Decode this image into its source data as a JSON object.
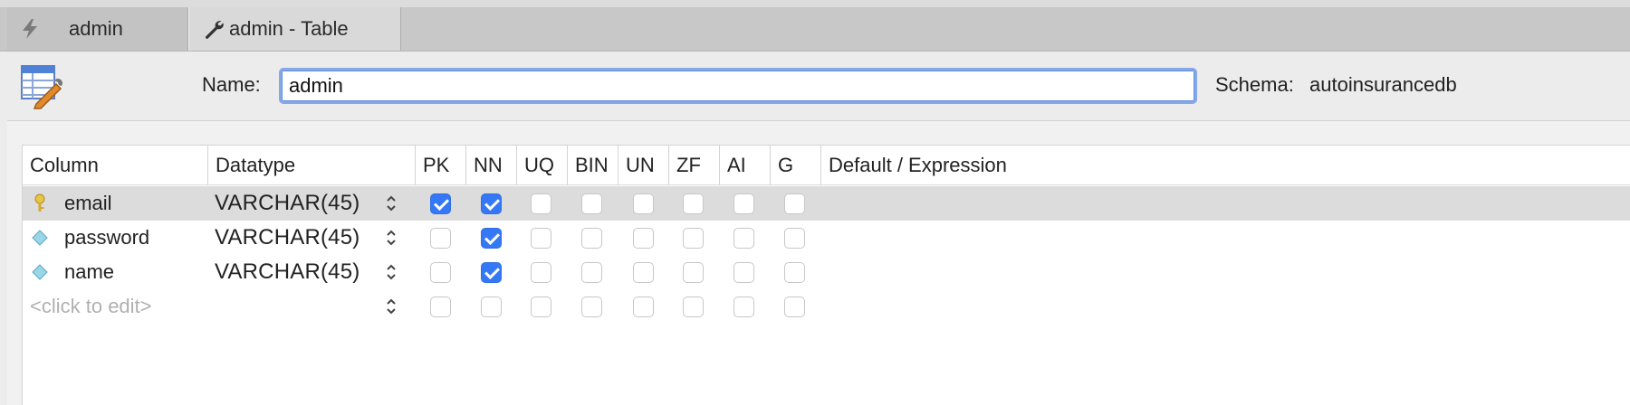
{
  "tabs": [
    {
      "label": "admin",
      "icon": "lightning-icon",
      "active": false
    },
    {
      "label": "admin - Table",
      "icon": "wrench-icon",
      "active": true
    }
  ],
  "header": {
    "name_label": "Name:",
    "name_value": "admin",
    "schema_label": "Schema:",
    "schema_value": "autoinsurancedb"
  },
  "grid": {
    "columns": [
      "Column",
      "Datatype",
      "PK",
      "NN",
      "UQ",
      "BIN",
      "UN",
      "ZF",
      "AI",
      "G",
      "Default / Expression"
    ],
    "rows": [
      {
        "name": "email",
        "icon": "primary-key-icon",
        "type": "VARCHAR(45)",
        "flags": {
          "PK": true,
          "NN": true,
          "UQ": false,
          "BIN": false,
          "UN": false,
          "ZF": false,
          "AI": false,
          "G": false
        },
        "selected": true
      },
      {
        "name": "password",
        "icon": "column-diamond-icon",
        "type": "VARCHAR(45)",
        "flags": {
          "PK": false,
          "NN": true,
          "UQ": false,
          "BIN": false,
          "UN": false,
          "ZF": false,
          "AI": false,
          "G": false
        },
        "selected": false
      },
      {
        "name": "name",
        "icon": "column-diamond-icon",
        "type": "VARCHAR(45)",
        "flags": {
          "PK": false,
          "NN": true,
          "UQ": false,
          "BIN": false,
          "UN": false,
          "ZF": false,
          "AI": false,
          "G": false
        },
        "selected": false
      }
    ],
    "new_row_placeholder": "<click to edit>"
  },
  "colors": {
    "checkbox_checked": "#3478f6",
    "selected_row": "#dcdcdc",
    "input_focus_ring": "#86a8e8"
  }
}
